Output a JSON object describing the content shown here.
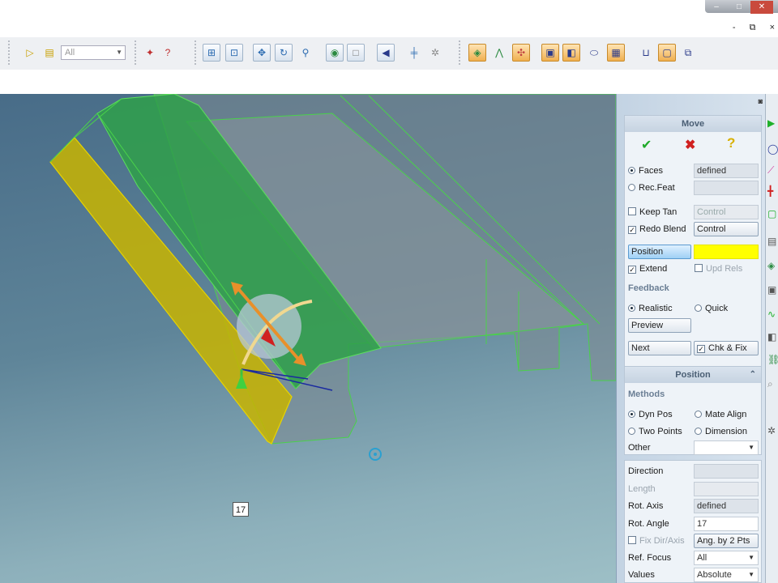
{
  "window": {
    "caption_buttons": [
      "–",
      "□",
      "✕"
    ],
    "mdi_buttons": [
      "-",
      "⧉",
      "×"
    ]
  },
  "toolbar": {
    "filter_value": "All",
    "icons": [
      "select-arrow-icon",
      "select-list-icon",
      "filter-icon",
      "sketch-arrow-icon",
      "help-cursor-icon",
      "zoom-all-icon",
      "zoom-window-icon",
      "pan-icon",
      "rotate-icon",
      "zoom-icon",
      "shaded-icon",
      "wireframe-icon",
      "previous-view-icon",
      "grid-icon",
      "settings-icon",
      "face-select-icon",
      "edge-select-icon",
      "vertex-select-icon",
      "solid-box-icon",
      "face-box-icon",
      "cylinder-icon",
      "surface-icon",
      "open-box-icon",
      "box-select-icon",
      "multi-box-icon"
    ],
    "accent_orange": "#f0b050"
  },
  "viewport": {
    "dimension_value": "17",
    "model_green": "#2fa04a",
    "model_yellow": "#c8b400",
    "background": "#5f8599"
  },
  "panel": {
    "move": {
      "title": "Move",
      "ok_icon": "green-check-icon",
      "cancel_icon": "red-x-icon",
      "help_icon": "yellow-question-icon",
      "faces_label": "Faces",
      "faces_value": "defined",
      "recfeat_label": "Rec.Feat",
      "recfeat_value": "",
      "keeptan_label": "Keep Tan",
      "keeptan_value": "Control",
      "redoblend_label": "Redo Blend",
      "redoblend_value": "Control",
      "position_label": "Position",
      "extend_label": "Extend",
      "updrels_label": "Upd Rels",
      "feedback_label": "Feedback",
      "realistic_label": "Realistic",
      "quick_label": "Quick",
      "preview_label": "Preview",
      "next_label": "Next",
      "chkfix_label": "Chk & Fix"
    },
    "position": {
      "title": "Position",
      "methods_label": "Methods",
      "dynpos_label": "Dyn Pos",
      "matealign_label": "Mate Align",
      "twopoints_label": "Two Points",
      "dimension_label": "Dimension",
      "other_label": "Other",
      "other_value": ""
    },
    "params": {
      "direction_label": "Direction",
      "direction_value": "",
      "length_label": "Length",
      "length_value": "",
      "rotaxis_label": "Rot. Axis",
      "rotaxis_value": "defined",
      "rotangle_label": "Rot. Angle",
      "rotangle_value": "17",
      "fixdir_label": "Fix Dir/Axis",
      "angby2_label": "Ang. by 2 Pts",
      "reffocus_label": "Ref. Focus",
      "reffocus_value": "All",
      "values_label": "Values",
      "values_value": "Absolute"
    }
  },
  "iconstrip": [
    "play-icon",
    "circle-icon",
    "curve-icon",
    "axis-icon",
    "rectangle-icon",
    "clipboard-icon",
    "layers-icon",
    "box-icon",
    "spline-icon",
    "cube-icon",
    "chain-icon",
    "search-icon",
    "gear-icon"
  ]
}
